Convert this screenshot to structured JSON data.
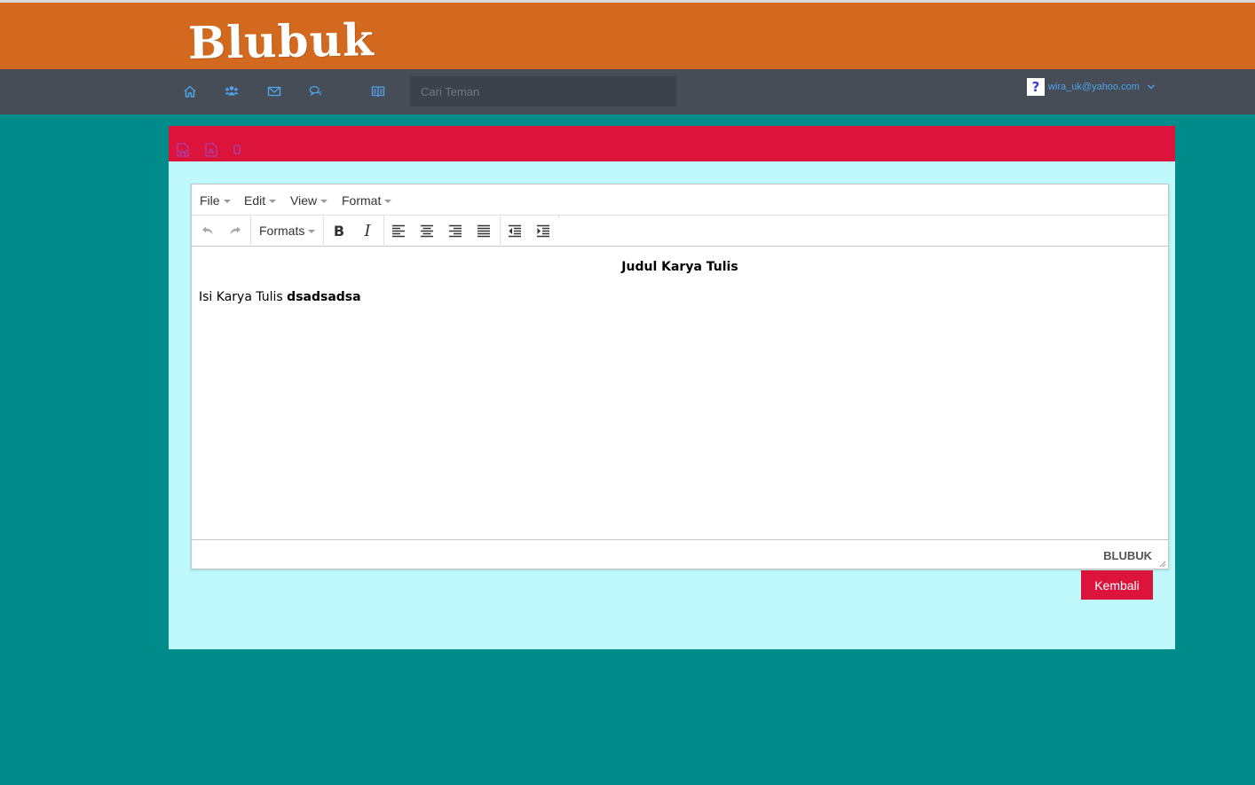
{
  "brand": {
    "logo_text": "Blubuk"
  },
  "nav": {
    "icons": [
      "home-icon",
      "friends-icon",
      "mail-icon",
      "chat-icon",
      "book-icon"
    ],
    "search": {
      "placeholder": "Cari Teman",
      "value": ""
    },
    "user": {
      "email": "wira_uk@yahoo.com",
      "avatar_glyph": "?"
    }
  },
  "panel": {
    "header_icons": [
      "word-doc-icon",
      "pdf-icon",
      "mobile-icon"
    ]
  },
  "editor": {
    "menu": {
      "file": "File",
      "edit": "Edit",
      "view": "View",
      "format": "Format"
    },
    "toolbar": {
      "formats": "Formats",
      "bold_glyph": "B",
      "italic_glyph": "I"
    },
    "content": {
      "title": "Judul Karya Tulis",
      "body_prefix": "Isi Karya Tulis ",
      "body_bold": "dsadsadsa"
    },
    "branding": "BLUBUK"
  },
  "actions": {
    "back": "Kembali"
  },
  "colors": {
    "background": "#008b8b",
    "brand_bar": "#d2691e",
    "nav_bar": "#464d57",
    "panel": "#bff9fb",
    "accent": "#dc143c",
    "nav_icon": "#4da3e8"
  }
}
